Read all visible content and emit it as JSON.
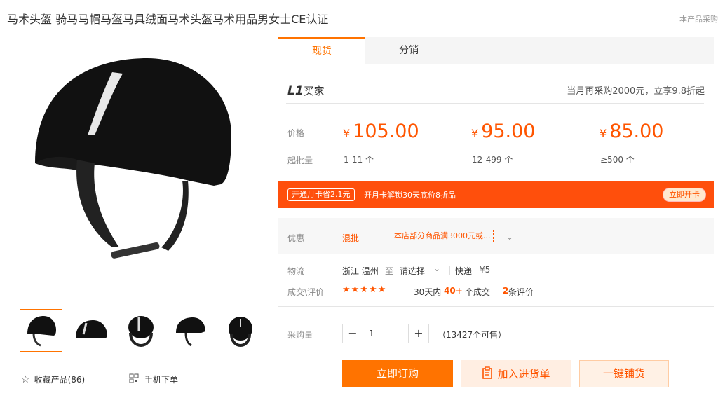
{
  "header": {
    "title": "马术头盔 骑马马帽马盔马具绒面马术头盔马术用品男女士CE认证",
    "right_note": "本产品采购"
  },
  "gallery": {
    "thumb_count": 5,
    "favorite_label": "收藏产品(86)",
    "mobile_label": "手机下单"
  },
  "tabs": [
    {
      "label": "现货"
    },
    {
      "label": "分销"
    }
  ],
  "buyer": {
    "tier": "L1",
    "tier_suffix": "买家",
    "promo": "当月再采购2000元，立享9.8折起"
  },
  "pricing": {
    "price_label": "价格",
    "qty_label": "起批量",
    "tiers": [
      {
        "currency": "¥",
        "price": "105.00",
        "qty": "1-11 个"
      },
      {
        "currency": "¥",
        "price": "95.00",
        "qty": "12-499 个"
      },
      {
        "currency": "¥",
        "price": "85.00",
        "qty": "≥500 个"
      }
    ]
  },
  "banner": {
    "pill": "开通月卡省2.1元",
    "text": "开月卡解锁30天底价8折品",
    "button": "立即开卡"
  },
  "discount": {
    "label": "优惠",
    "tag": "混批",
    "coupon": "本店部分商品满3000元或...",
    "chevron": "chevron-down-icon"
  },
  "logistics": {
    "label": "物流",
    "from": "浙江 温州",
    "to_word": "至",
    "dest": "请选择",
    "carrier": "快递",
    "fee": "¥5"
  },
  "reviews": {
    "label": "成交\\评价",
    "stars": "★★★★★",
    "period": "30天内",
    "count": "40+",
    "count_suffix": "个成交",
    "review_num": "2",
    "review_suffix": "条评价"
  },
  "purchase": {
    "label": "采购量",
    "quantity": "1",
    "stock": "（13427个可售）"
  },
  "actions": {
    "buy": "立即订购",
    "cart": "加入进货单",
    "distribute": "一键铺货"
  },
  "colors": {
    "accent": "#ff7300",
    "price": "#ff5500",
    "banner": "#ff4f0c"
  }
}
